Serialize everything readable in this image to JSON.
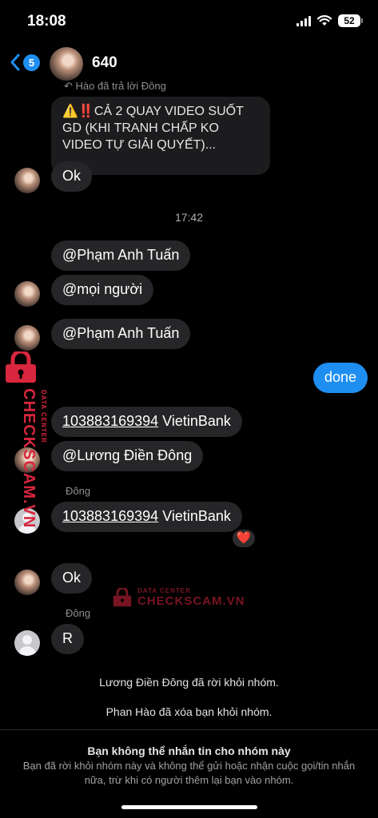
{
  "status_bar": {
    "time": "18:08",
    "battery": "52"
  },
  "header": {
    "back_badge": "5",
    "group_name": "640"
  },
  "messages": {
    "reply_note": "Hào đã trả lời Đông",
    "quoted_text": "⚠️‼️CẢ 2 QUAY VIDEO SUỐT GD (KHI TRANH CHẤP KO VIDEO TỰ GIẢI QUYẾT)...",
    "ok_1": "Ok",
    "time_separator": "17:42",
    "mention_1": "@Phạm Anh Tuấn",
    "mention_2": "@mọi người",
    "mention_3": "@Phạm Anh Tuấn",
    "outgoing": "done",
    "account_1": "103883169394",
    "bank_1": " VietinBank",
    "mention_4": "@Lương Điền Đông",
    "sender_1": "Đông",
    "account_2": "103883169394",
    "bank_2": " VietinBank",
    "reaction": "❤️",
    "ok_2": "Ok",
    "sender_2": "Đông",
    "r_msg": "R"
  },
  "system": {
    "left_group": "Lương Điền Đông đã rời khỏi nhóm.",
    "removed": "Phan Hào đã xóa bạn khỏi nhóm."
  },
  "footer": {
    "title": "Bạn không thể nhắn tin cho nhóm này",
    "text": "Bạn đã rời khỏi nhóm này và không thể gửi hoặc nhận cuộc gọi/tin nhắn nữa, trừ khi có người thêm lại bạn vào nhóm."
  },
  "watermark": {
    "brand": "CHECKSCAM.VN",
    "tagline": "DATA CENTER"
  },
  "colors": {
    "accent": "#1f8ef1",
    "bubble_incoming": "#262628",
    "watermark": "#d7263d"
  }
}
